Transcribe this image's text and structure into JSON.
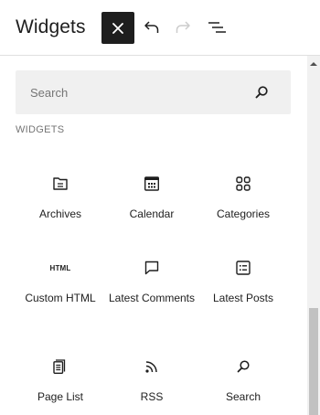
{
  "header": {
    "title": "Widgets",
    "close_icon": "close-icon",
    "undo_icon": "undo-icon",
    "redo_icon": "redo-icon",
    "outline_icon": "list-view-icon"
  },
  "search": {
    "placeholder": "Search",
    "value": "",
    "icon": "search-icon"
  },
  "section": {
    "heading": "WIDGETS"
  },
  "blocks": [
    {
      "label": "Archives",
      "icon": "archive-icon"
    },
    {
      "label": "Calendar",
      "icon": "calendar-icon"
    },
    {
      "label": "Categories",
      "icon": "categories-icon"
    },
    {
      "label": "Custom HTML",
      "icon": "html-icon",
      "icon_text": "HTML"
    },
    {
      "label": "Latest Comments",
      "icon": "comment-icon"
    },
    {
      "label": "Latest Posts",
      "icon": "post-list-icon"
    },
    {
      "label": "Page List",
      "icon": "pages-icon"
    },
    {
      "label": "RSS",
      "icon": "rss-icon"
    },
    {
      "label": "Search",
      "icon": "search-icon"
    }
  ],
  "colors": {
    "primary_text": "#1e1e1e",
    "muted_text": "#757575",
    "search_bg": "#f0f0f0",
    "close_bg": "#1e1e1e",
    "disabled_icon": "#cccccc"
  }
}
